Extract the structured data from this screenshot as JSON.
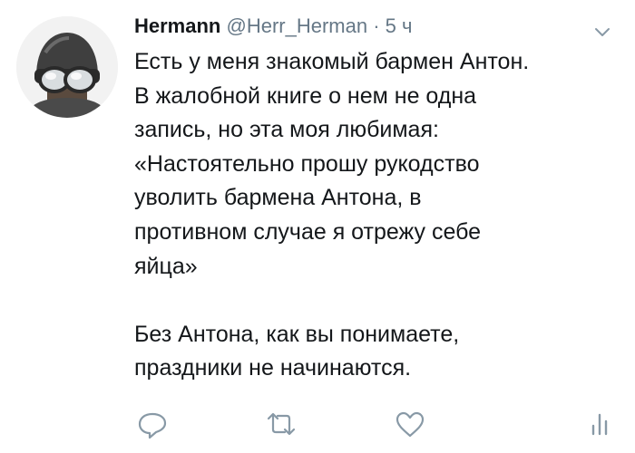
{
  "tweet": {
    "author_name": "Hermann",
    "handle": "@Herr_Herman",
    "separator": "·",
    "time": "5 ч",
    "paragraph_1": "Есть у меня знакомый бармен Антон.\nВ жалобной книге о нем не одна\nзапись,  но эта моя любимая:\n«Настоятельно прошу рукодство\nуволить бармена Антона, в\nпротивном случае я отрежу себе\nяйца»",
    "paragraph_2": "Без Антона, как вы понимаете,\nпраздники не начинаются."
  },
  "icons": {
    "avatar": "avatar-goggles-helmet",
    "more": "chevron-down-icon",
    "reply": "reply-icon",
    "retweet": "retweet-icon",
    "like": "heart-icon",
    "analytics": "analytics-icon"
  },
  "colors": {
    "text": "#14171a",
    "secondary": "#657786",
    "icon": "#8899a6",
    "background": "#ffffff"
  }
}
